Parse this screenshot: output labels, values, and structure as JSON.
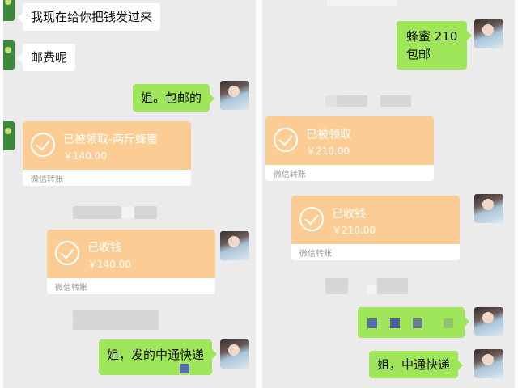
{
  "left": {
    "msg1": "我现在给你把钱发过来",
    "msg2": "邮费呢",
    "msg3": "姐。包邮的",
    "transfer1": {
      "title": "已被领取-两斤蜂蜜",
      "amount": "￥140.00",
      "footer": "微信转账"
    },
    "transfer2": {
      "title": "已收钱",
      "amount": "￥140.00",
      "footer": "微信转账"
    },
    "msg4": "姐，发的中通快递"
  },
  "right": {
    "msg1_line1": "蜂蜜 210",
    "msg1_line2": "包邮",
    "transfer1": {
      "title": "已被领取",
      "amount": "￥210.00",
      "footer": "微信转账"
    },
    "transfer2": {
      "title": "已收钱",
      "amount": "￥210.00",
      "footer": "微信转账"
    },
    "msg3": "姐，中通快递"
  },
  "colors": {
    "outgoing_bubble": "#9fe65a",
    "incoming_bubble": "#ffffff",
    "transfer_card": "#fbcd95",
    "chat_background": "#ebebeb"
  },
  "icons": [
    "contact-avatar",
    "user-avatar",
    "transfer-check-icon"
  ]
}
